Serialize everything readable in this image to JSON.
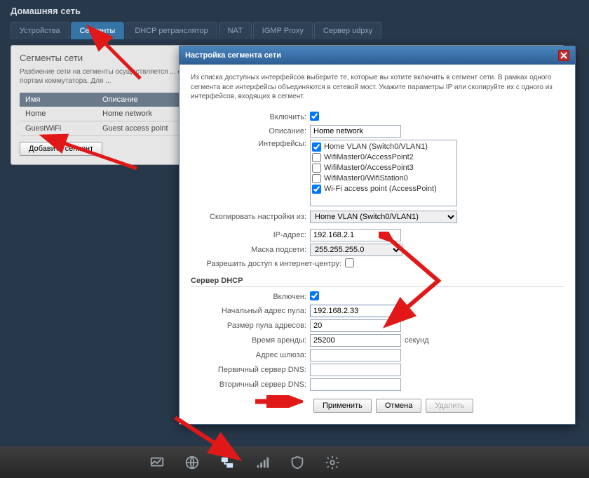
{
  "page": {
    "title": "Домашняя сеть"
  },
  "tabs": [
    "Устройства",
    "Сегменты",
    "DHCP ретранслятор",
    "NAT",
    "IGMP Proxy",
    "Сервер udpxy"
  ],
  "activeTab": 1,
  "segments_panel": {
    "title": "Сегменты сети",
    "desc": "Разбиение сети на сегменты осуществляется ... объединяет порты встроенного коммутатора ... схемы предоставления услуг, для подключения ... привязанные к портам коммутатора. Для ...",
    "cols": [
      "Имя",
      "Описание"
    ],
    "rows": [
      {
        "name": "Home",
        "desc": "Home network"
      },
      {
        "name": "GuestWiFi",
        "desc": "Guest access point"
      }
    ],
    "add_btn": "Добавить сегмент"
  },
  "modal": {
    "title": "Настройка сегмента сети",
    "info": "Из списка доступных интерфейсов выберите те, которые вы хотите включить в сегмент сети. В рамках одного сегмента все интерфейсы объединяются в сетевой мост. Укажите параметры IP или скопируйте их с одного из интерфейсов, входящих в сегмент.",
    "labels": {
      "enable": "Включить:",
      "descr": "Описание:",
      "ifaces": "Интерфейсы:",
      "copy_from": "Скопировать настройки из:",
      "ip": "IP-адрес:",
      "mask": "Маска подсети:",
      "allow_remote": "Разрешить доступ к интернет-центру:",
      "dhcp_section": "Сервер DHCP",
      "dhcp_enabled": "Включен:",
      "pool_start": "Начальный адрес пула:",
      "pool_size": "Размер пула адресов:",
      "lease": "Время аренды:",
      "gateway": "Адрес шлюза:",
      "dns1": "Первичный сервер DNS:",
      "dns2": "Вторичный сервер DNS:",
      "seconds": "секунд"
    },
    "values": {
      "enable": true,
      "descr": "Home network",
      "ifaces": [
        {
          "label": "Home VLAN (Switch0/VLAN1)",
          "checked": true
        },
        {
          "label": "WifiMaster0/AccessPoint2",
          "checked": false
        },
        {
          "label": "WifiMaster0/AccessPoint3",
          "checked": false
        },
        {
          "label": "WifiMaster0/WifiStation0",
          "checked": false
        },
        {
          "label": "Wi-Fi access point (AccessPoint)",
          "checked": true
        }
      ],
      "copy_from": "Home VLAN (Switch0/VLAN1)",
      "ip": "192.168.2.1",
      "mask": "255.255.255.0",
      "allow_remote": false,
      "dhcp_enabled": true,
      "pool_start": "192.168.2.33",
      "pool_size": "20",
      "lease": "25200",
      "gateway": "",
      "dns1": "",
      "dns2": ""
    },
    "buttons": {
      "apply": "Применить",
      "cancel": "Отмена",
      "delete": "Удалить"
    }
  },
  "bottombar": [
    "monitor-icon",
    "globe-icon",
    "network-icon",
    "signal-icon",
    "shield-icon",
    "gear-icon"
  ]
}
